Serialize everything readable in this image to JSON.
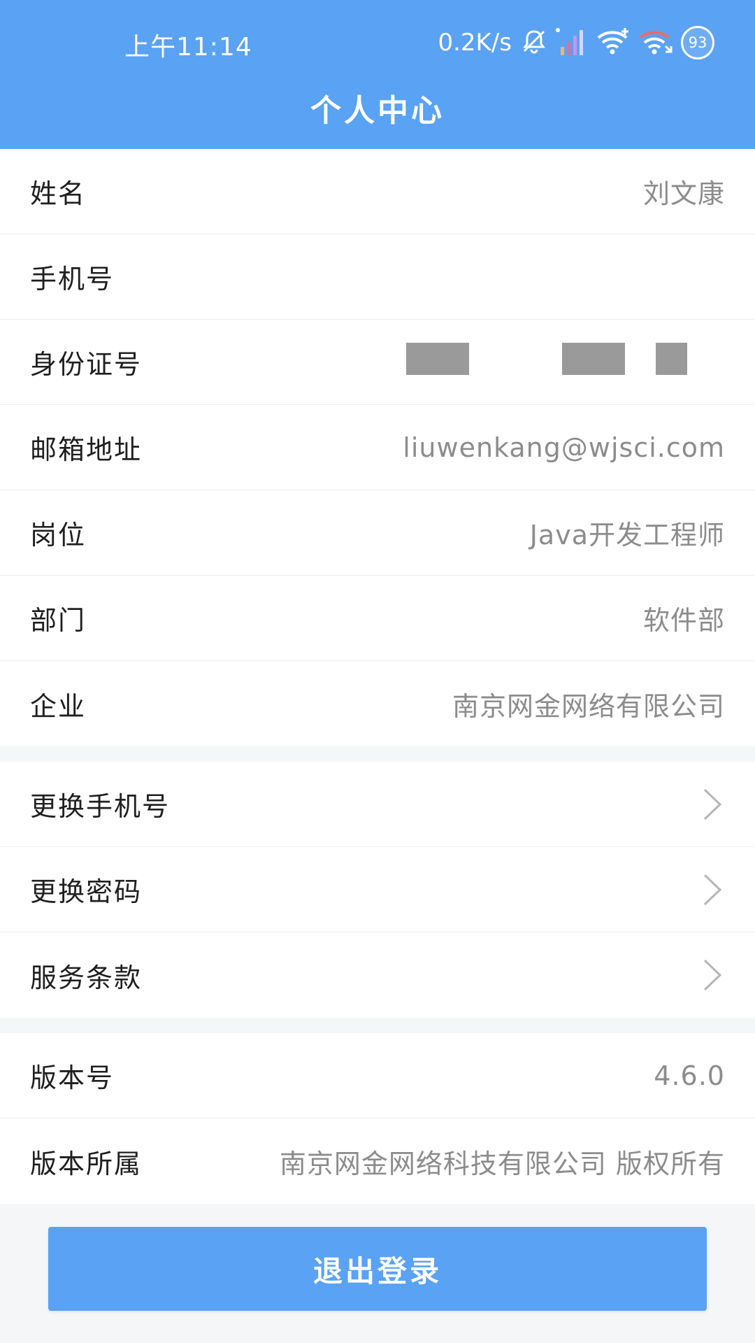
{
  "status_bar": {
    "time": "上午11:14",
    "net_speed": "0.2K/s",
    "battery": "93"
  },
  "header": {
    "title": "个人中心"
  },
  "profile": [
    {
      "label": "姓名",
      "value": "刘文康"
    },
    {
      "label": "手机号",
      "value": ""
    },
    {
      "label": "身份证号",
      "value": ""
    },
    {
      "label": "邮箱地址",
      "value": "liuwenkang@wjsci.com"
    },
    {
      "label": "岗位",
      "value": "Java开发工程师"
    },
    {
      "label": "部门",
      "value": "软件部"
    },
    {
      "label": "企业",
      "value": "南京网金网络有限公司"
    }
  ],
  "actions": [
    {
      "label": "更换手机号"
    },
    {
      "label": "更换密码"
    },
    {
      "label": "服务条款"
    }
  ],
  "about": [
    {
      "label": "版本号",
      "value": "4.6.0"
    },
    {
      "label": "版本所属",
      "value": "南京网金网络科技有限公司 版权所有"
    }
  ],
  "logout_label": "退出登录",
  "colors": {
    "header_bg": "#5aa2f3",
    "button_bg": "#5aa2f3",
    "page_bg": "#f5f6f8",
    "value_text": "#8c8c8c",
    "label_text": "#1f1f1f"
  }
}
